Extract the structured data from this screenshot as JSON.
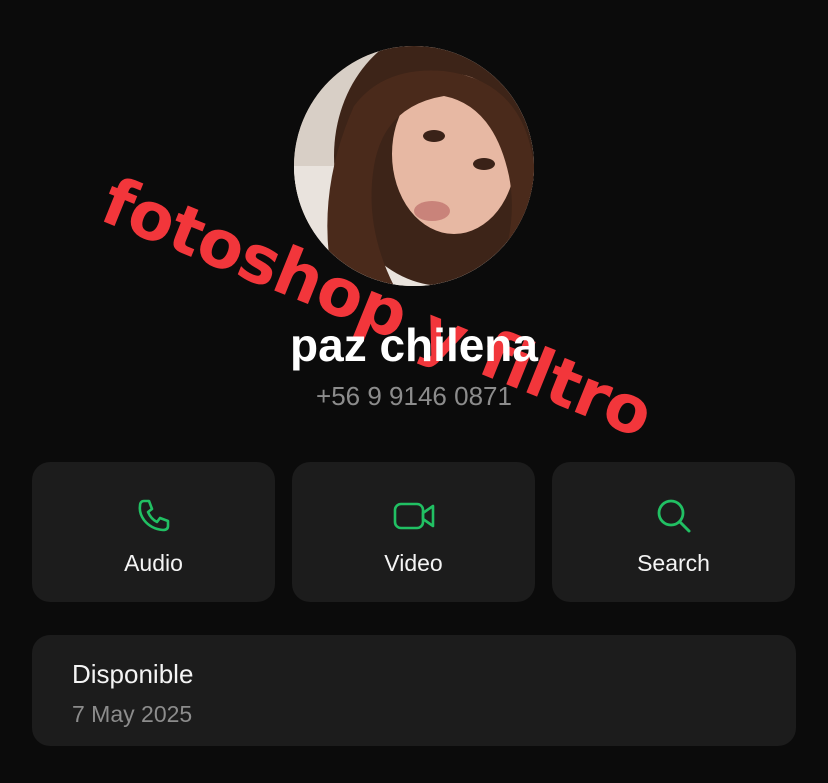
{
  "contact": {
    "name": "paz chilena",
    "phone": "+56 9 9146 0871",
    "avatar": "profile-photo"
  },
  "overlay": {
    "text": "fotoshop y filtro",
    "color": "#f2363b"
  },
  "actions": [
    {
      "label": "Audio",
      "icon": "phone-icon"
    },
    {
      "label": "Video",
      "icon": "video-camera-icon"
    },
    {
      "label": "Search",
      "icon": "search-icon"
    }
  ],
  "status": {
    "text": "Disponible",
    "date": "7 May 2025"
  },
  "colors": {
    "accent": "#21c063",
    "background": "#0b0b0b",
    "card": "#1c1c1c"
  }
}
